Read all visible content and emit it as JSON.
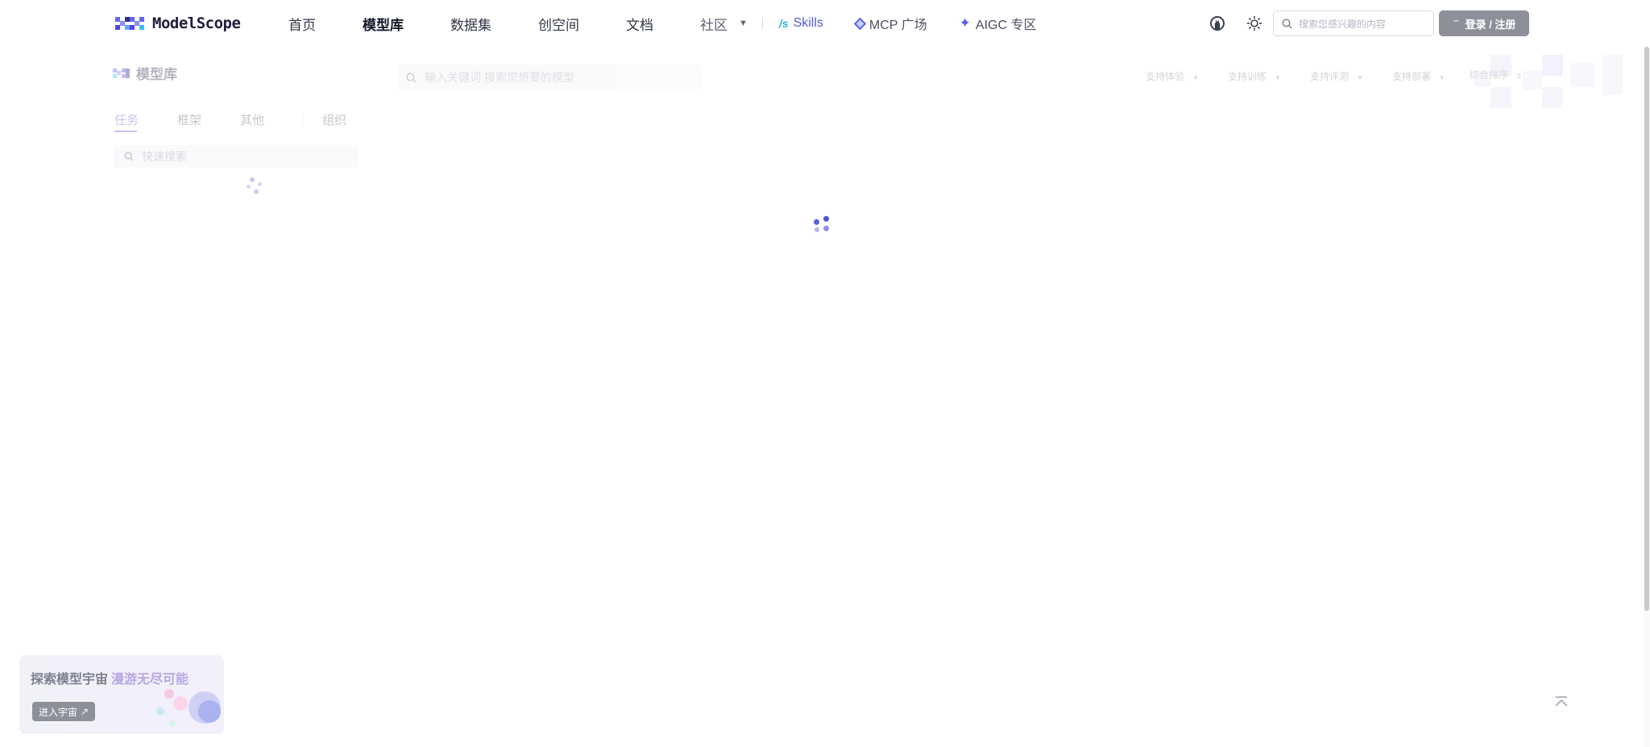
{
  "brand": {
    "logo_text": "ModelScope"
  },
  "nav": {
    "links": [
      "首页",
      "模型库",
      "数据集",
      "创空间",
      "文档",
      "社区"
    ],
    "skills": "Skills",
    "mcp": "MCP 广场",
    "aigc": "AIGC 专区"
  },
  "header": {
    "search_placeholder": "搜索您感兴趣的内容",
    "login_label": "登录 / 注册"
  },
  "sidebar": {
    "title": "模型库",
    "tabs": [
      "任务",
      "框架",
      "其他",
      "组织"
    ],
    "quick_search_placeholder": "快速搜索"
  },
  "main": {
    "search_placeholder": "输入关键词 搜索您想要的模型",
    "filters": [
      "支持体验",
      "支持训练",
      "支持评测",
      "支持部署",
      "综合排序"
    ]
  },
  "promo": {
    "title": "探索模型宇宙",
    "subtitle": "漫游无尽可能",
    "button": "进入宇宙"
  },
  "colors": {
    "accent": "#6a6ae0",
    "button_gray": "#8e9099"
  }
}
